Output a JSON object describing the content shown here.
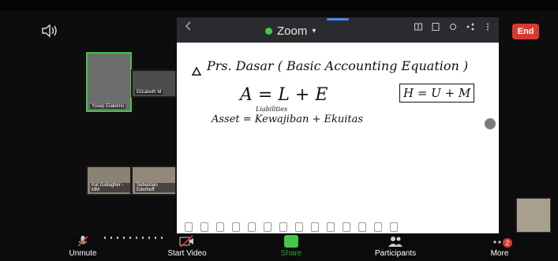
{
  "header": {
    "app_title": "Zoom",
    "end_label": "End"
  },
  "whiteboard": {
    "lines": [
      {
        "text": "Prs. Dasar ( Basic Accounting Equation )"
      },
      {
        "text": "A = L + E"
      },
      {
        "text": "Liabilities"
      },
      {
        "text": "Asset = Kewajiban + Ekuitas"
      },
      {
        "text": "H = U + M"
      }
    ]
  },
  "participants": {
    "tiles": [
      {
        "name": "Yosep Eiakemo"
      },
      {
        "name": "Elizabeth M"
      },
      {
        "name": "Kat Gallagher - MM"
      },
      {
        "name": "Sebastian Ederhoff"
      }
    ]
  },
  "bottom_bar": {
    "unmute_label": "Unmute",
    "start_video_label": "Start Video",
    "share_label": "Share",
    "participants_label": "Participants",
    "more_label": "More",
    "more_badge": "2"
  },
  "colors": {
    "end_red": "#d93a30",
    "active_green": "#42c54b"
  }
}
